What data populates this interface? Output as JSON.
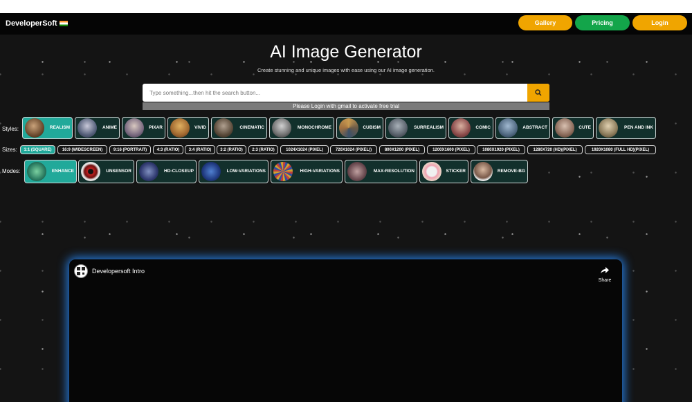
{
  "header": {
    "brand": "DeveloperSoft",
    "nav": {
      "gallery": "Gallery",
      "pricing": "Pricing",
      "login": "Login"
    }
  },
  "hero": {
    "title": "AI Image Generator",
    "subtitle": "Create stunning and unique images with ease using our AI image generation."
  },
  "search": {
    "placeholder": "Type something...then hit the search button...",
    "value": "",
    "notice": "Please Login with gmail to activate free trial"
  },
  "styles": {
    "label": "Styles:",
    "selected": "REALISM",
    "items": [
      "REALISM",
      "ANIME",
      "PIXAR",
      "VIVID",
      "CINEMATIC",
      "MONOCHROME",
      "CUBISM",
      "SURREALISM",
      "COMIC",
      "ABSTRACT",
      "CUTE",
      "PEN AND INK"
    ]
  },
  "sizes": {
    "label": "Sizes:",
    "selected": "1:1 (SQUARE)",
    "items": [
      "1:1 (SQUARE)",
      "16:9 (WIDESCREEN)",
      "9:16 (PORTRAIT)",
      "4:3 (RATIO)",
      "3:4 (RATIO)",
      "3:2 (RATIO)",
      "2:3 (RATIO)",
      "1024X1024 (PIXEL)",
      "720X1024 (PIXEL))",
      "800X1200 (PIXEL)",
      "1200X1600 (PIXEL)",
      "1080X1920 (PIXEL)",
      "1280X720 (HD)(PIXEL)",
      "1920X1080 (FULL HD)(PIXEL)"
    ]
  },
  "modes": {
    "label": "Modes:",
    "selected": "ENHANCE",
    "items": [
      "ENHANCE",
      "UNSENSOR",
      "HD-CLOSEUP",
      "LOW-VARIATIONS",
      "HIGH-VARIATIONS",
      "MAX-RESOLUTION",
      "STICKER",
      "REMOVE-BG"
    ]
  },
  "video": {
    "title": "Developersoft Intro",
    "share": "Share"
  },
  "colors": {
    "accent_yellow": "#f0a500",
    "accent_green": "#13a54a",
    "selected_teal": "#21a99a",
    "chip_bg": "#12302c",
    "glow_blue": "#288cff"
  }
}
